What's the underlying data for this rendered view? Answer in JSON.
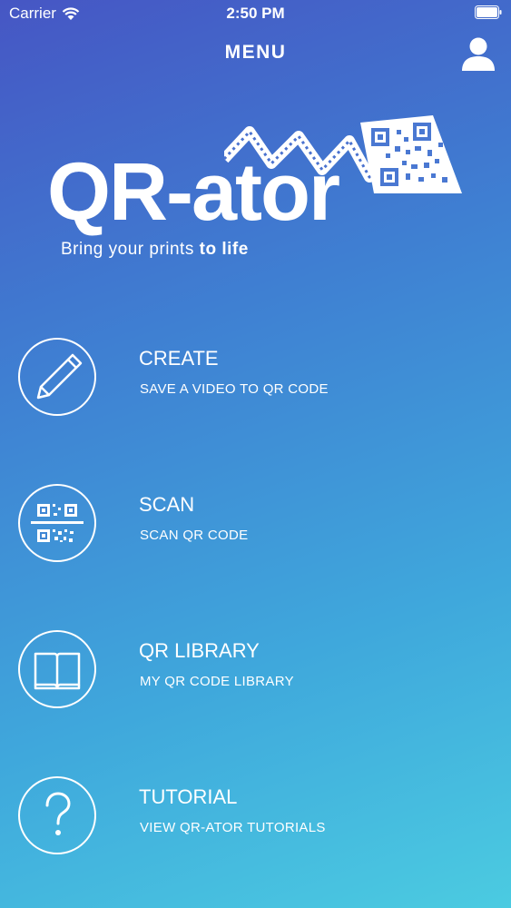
{
  "status_bar": {
    "carrier": "Carrier",
    "time": "2:50 PM"
  },
  "nav": {
    "title": "MENU"
  },
  "logo": {
    "text": "QR-ator",
    "tagline_regular": "Bring your prints ",
    "tagline_bold": "to life"
  },
  "menu": {
    "items": [
      {
        "title": "CREATE",
        "subtitle": "SAVE A VIDEO TO QR CODE",
        "icon": "pencil-icon"
      },
      {
        "title": "SCAN",
        "subtitle": "SCAN QR CODE",
        "icon": "qr-scan-icon"
      },
      {
        "title": "QR LIBRARY",
        "subtitle": "MY QR CODE LIBRARY",
        "icon": "book-icon"
      },
      {
        "title": "TUTORIAL",
        "subtitle": "VIEW QR-ATOR TUTORIALS",
        "icon": "question-icon"
      }
    ]
  },
  "colors": {
    "gradient_top": "#4656c4",
    "gradient_bottom": "#4bcbe1",
    "foreground": "#ffffff"
  }
}
